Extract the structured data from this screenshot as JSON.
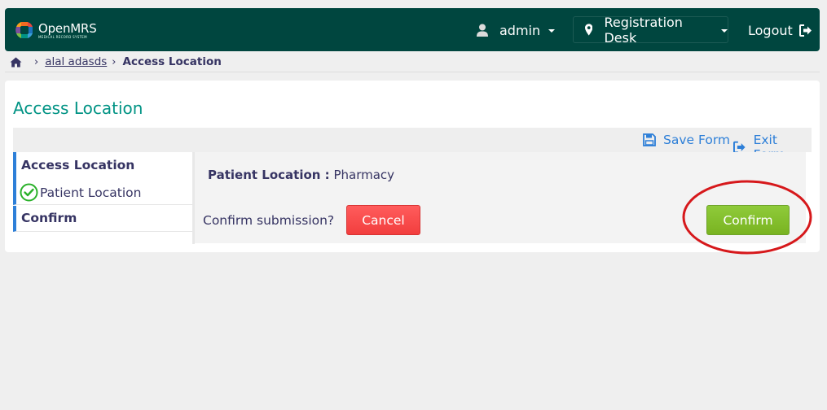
{
  "colors": {
    "header_bg": "#00463f",
    "title_teal": "#009384",
    "link_blue": "#2d7fd8",
    "cancel_red": "#f23e3e",
    "confirm_green": "#80bb2b",
    "annotation_red": "#d6181b"
  },
  "header": {
    "logo_name": "OpenMRS",
    "logo_sub": "MEDICAL RECORD SYSTEM",
    "user": "admin",
    "user_icon": "user-icon",
    "location": "Registration Desk",
    "location_icon": "map-marker-icon",
    "logout": "Logout",
    "logout_icon": "sign-out-icon"
  },
  "breadcrumb": {
    "home_icon": "home-icon",
    "sep": "›",
    "patient": "alal adasds",
    "current": "Access Location"
  },
  "form": {
    "title": "Access Location",
    "save_label": "Save Form",
    "save_icon": "floppy-disk-icon",
    "exit_label": "Exit Form",
    "exit_icon": "sign-out-icon",
    "nav": {
      "section1_title": "Access Location",
      "field1": "Patient Location",
      "field1_icon": "check-circle-icon",
      "section2_title": "Confirm"
    },
    "summary": {
      "label": "Patient Location :",
      "value": "Pharmacy"
    },
    "confirm_question": "Confirm submission?",
    "cancel_label": "Cancel",
    "confirm_label": "Confirm"
  }
}
